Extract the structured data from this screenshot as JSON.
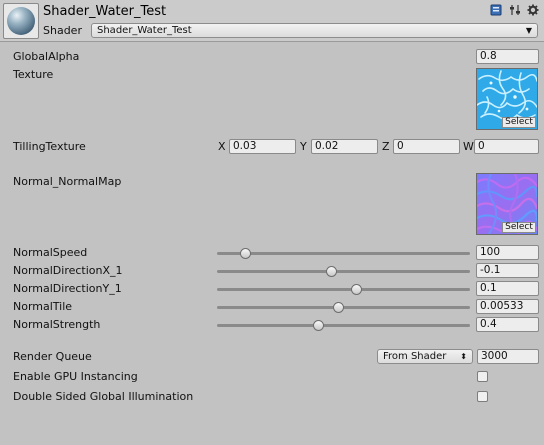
{
  "header": {
    "material_name": "Shader_Water_Test",
    "shader_label": "Shader",
    "shader_value": "Shader_Water_Test",
    "icons": [
      "book-icon",
      "preset-sliders-icon",
      "gear-icon"
    ]
  },
  "properties": {
    "global_alpha": {
      "label": "GlobalAlpha",
      "value": "0.8"
    },
    "texture": {
      "label": "Texture",
      "select_label": "Select"
    },
    "tilling_texture": {
      "label": "TillingTexture",
      "x_label": "X",
      "x": "0.03",
      "y_label": "Y",
      "y": "0.02",
      "z_label": "Z",
      "z": "0",
      "w_label": "W",
      "w": "0"
    },
    "normal_map": {
      "label": "Normal_NormalMap",
      "select_label": "Select"
    },
    "sliders": [
      {
        "label": "NormalSpeed",
        "value": "100",
        "fraction": 0.11
      },
      {
        "label": "NormalDirectionX_1",
        "value": "-0.1",
        "fraction": 0.45
      },
      {
        "label": "NormalDirectionY_1",
        "value": "0.1",
        "fraction": 0.55
      },
      {
        "label": "NormalTile",
        "value": "0.00533",
        "fraction": 0.48
      },
      {
        "label": "NormalStrength",
        "value": "0.4",
        "fraction": 0.4
      }
    ]
  },
  "advanced": {
    "render_queue_label": "Render Queue",
    "render_queue_mode": "From Shader",
    "render_queue_value": "3000",
    "gpu_instancing_label": "Enable GPU Instancing",
    "gpu_instancing_checked": false,
    "double_sided_gi_label": "Double Sided Global Illumination",
    "double_sided_gi_checked": false
  }
}
